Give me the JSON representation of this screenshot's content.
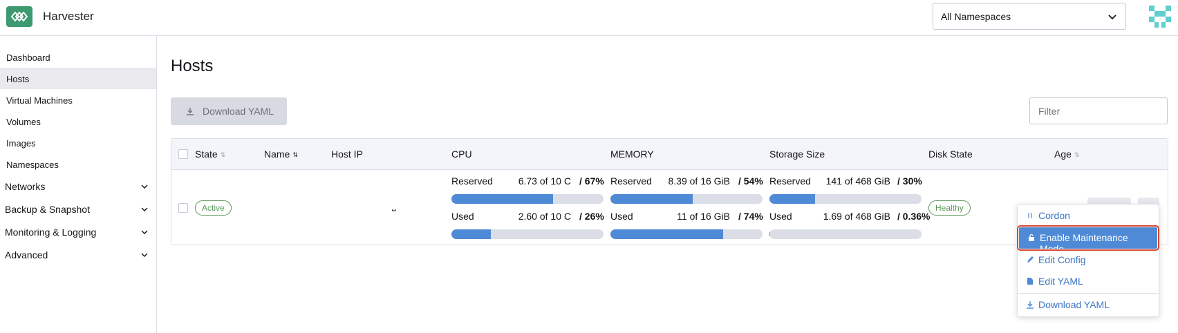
{
  "header": {
    "app_title": "Harvester",
    "namespace_select": "All Namespaces"
  },
  "sidebar": {
    "items": [
      {
        "label": "Dashboard"
      },
      {
        "label": "Hosts"
      },
      {
        "label": "Virtual Machines"
      },
      {
        "label": "Volumes"
      },
      {
        "label": "Images"
      },
      {
        "label": "Namespaces"
      }
    ],
    "groups": [
      {
        "label": "Networks"
      },
      {
        "label": "Backup & Snapshot"
      },
      {
        "label": "Monitoring & Logging"
      },
      {
        "label": "Advanced"
      }
    ],
    "active": "Hosts"
  },
  "page": {
    "title": "Hosts",
    "download_button": "Download YAML",
    "filter_placeholder": "Filter"
  },
  "table": {
    "columns": [
      "State",
      "Name",
      "Host IP",
      "CPU",
      "MEMORY",
      "Storage Size",
      "Disk State",
      "Age"
    ],
    "row": {
      "state": "Active",
      "disk_state": "Healthy",
      "cpu": {
        "reserved_label": "Reserved",
        "reserved_value": "6.73 of 10 C",
        "reserved_pct": "/ 67%",
        "reserved_fraction": 0.67,
        "used_label": "Used",
        "used_value": "2.60 of 10 C",
        "used_pct": "/ 26%",
        "used_fraction": 0.26
      },
      "memory": {
        "reserved_label": "Reserved",
        "reserved_value": "8.39 of 16 GiB",
        "reserved_pct": "/ 54%",
        "reserved_fraction": 0.54,
        "used_label": "Used",
        "used_value": "11 of 16 GiB",
        "used_pct": "/ 74%",
        "used_fraction": 0.74
      },
      "storage": {
        "reserved_label": "Reserved",
        "reserved_value": "141 of 468 GiB",
        "reserved_pct": "/ 30%",
        "reserved_fraction": 0.3,
        "used_label": "Used",
        "used_value": "1.69 of 468 GiB",
        "used_pct": "/ 0.36%",
        "used_fraction": 0.0036
      }
    }
  },
  "context_menu": {
    "items": [
      {
        "label": "Cordon",
        "icon": "cordon-icon"
      },
      {
        "label": "Enable Maintenance Mode",
        "icon": "lock-icon"
      },
      {
        "label": "Edit Config",
        "icon": "pencil-icon"
      },
      {
        "label": "Edit YAML",
        "icon": "file-icon"
      },
      {
        "label": "Download YAML",
        "icon": "download-icon"
      }
    ]
  },
  "colors": {
    "brand": "#3d9970",
    "accent": "#4f8ad6",
    "highlight_outline": "#d9452e",
    "success": "#5d995d"
  }
}
